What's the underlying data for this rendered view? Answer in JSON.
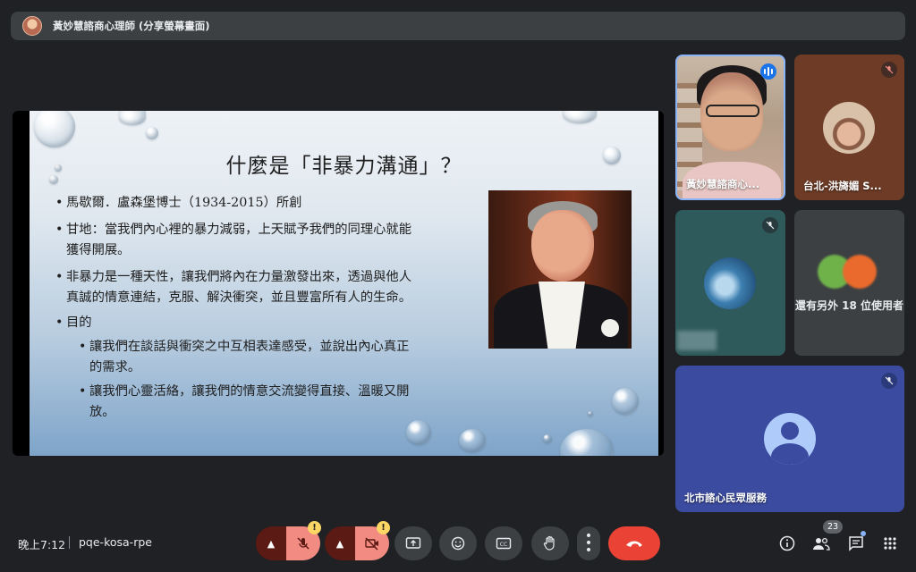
{
  "banner": {
    "presenter_label": "黃妙慧諮商心理師 (分享螢幕畫面)"
  },
  "slide": {
    "title": "什麼是「非暴力溝通」？",
    "bullets": [
      {
        "text": "馬歇爾．盧森堡博士（1934-2015）所創"
      },
      {
        "line1": "甘地：當我們內心裡的暴力減弱，上天賦予我們的同理心就能",
        "line2": "獲得開展。"
      },
      {
        "line1": "非暴力是一種天性，讓我們將內在力量激發出來，透過與他人",
        "line2": "真誠的情意連結，克服、解決衝突，並且豐富所有人的生命。"
      },
      {
        "text": "目的"
      }
    ],
    "sub_bullets": [
      {
        "line1": "讓我們在談話與衝突之中互相表達感受，並說出內心真正",
        "line2": "的需求。"
      },
      {
        "line1": "讓我們心靈活絡，讓我們的情意交流變得直接、溫暖又開",
        "line2": "放。"
      }
    ]
  },
  "participants": [
    {
      "name": "黃妙慧諮商心...",
      "speaking": true
    },
    {
      "name": "台北-洪旖媚 S...",
      "muted": true
    },
    {
      "name": "",
      "muted": true
    },
    {
      "name": "還有另外 18 位使用者"
    },
    {
      "name": "北市諮心民眾服務",
      "muted": true
    }
  ],
  "bottom_bar": {
    "time": "晚上7:12",
    "meeting_code": "pqe-kosa-rpe",
    "people_count": "23",
    "warning_glyph": "!"
  },
  "colors": {
    "end_call": "#ea4335",
    "mic_off_bg": "#f28b82",
    "speaking": "#1a73e8",
    "accent_border": "#8ab4f8"
  }
}
